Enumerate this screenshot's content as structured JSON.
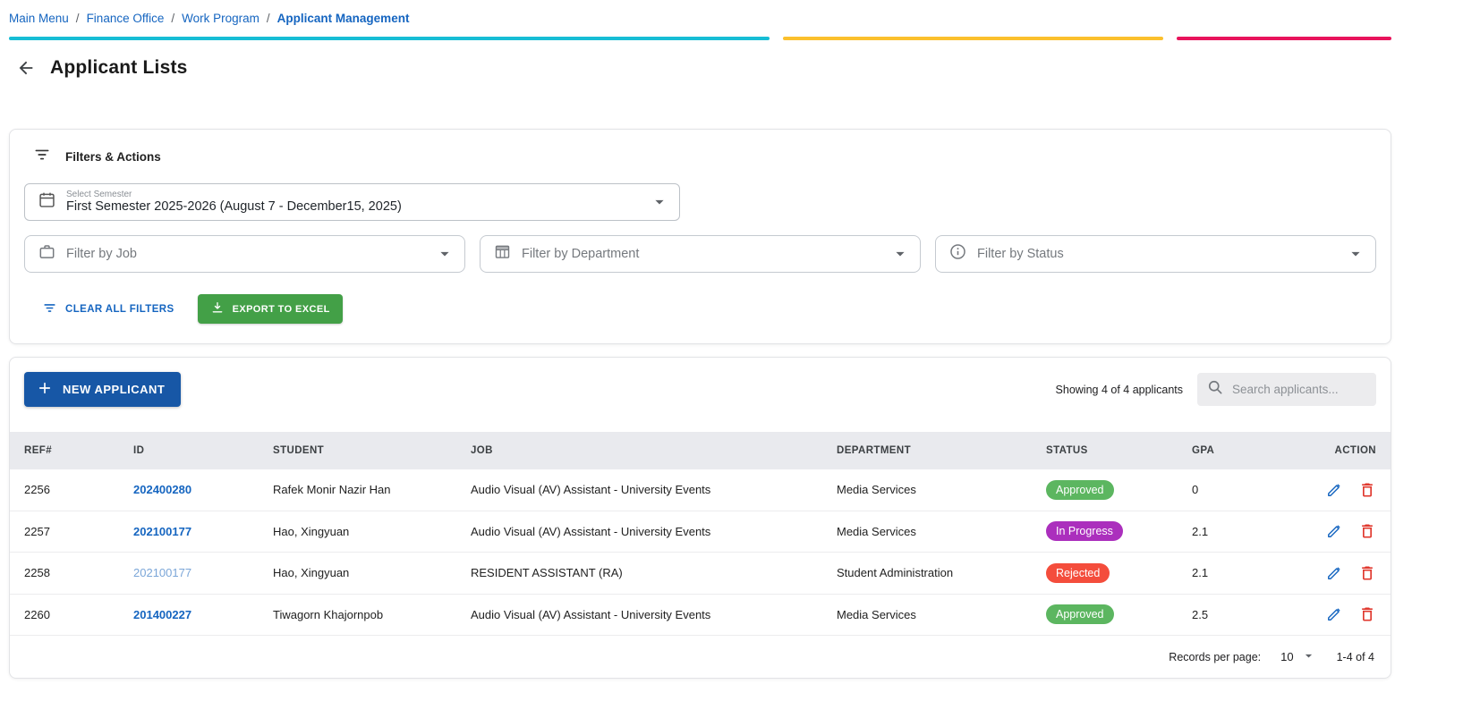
{
  "breadcrumb": {
    "separator": "/",
    "items": [
      {
        "label": "Main Menu",
        "current": false
      },
      {
        "label": "Finance Office",
        "current": false
      },
      {
        "label": "Work Program",
        "current": false
      },
      {
        "label": "Applicant Management",
        "current": true
      }
    ]
  },
  "page": {
    "title": "Applicant Lists"
  },
  "filters": {
    "title": "Filters & Actions",
    "semester_label": "Select Semester",
    "semester_value": "First Semester 2025-2026 (August 7 - December15, 2025)",
    "job_placeholder": "Filter by Job",
    "department_placeholder": "Filter by Department",
    "status_placeholder": "Filter by Status",
    "clear_button_label": "CLEAR ALL FILTERS",
    "export_button_label": "EXPORT TO EXCEL"
  },
  "toolbar": {
    "new_applicant_label": "NEW APPLICANT",
    "showing_text": "Showing 4 of 4 applicants",
    "search_placeholder": "Search applicants..."
  },
  "table": {
    "headers": [
      "REF#",
      "ID",
      "STUDENT",
      "JOB",
      "DEPARTMENT",
      "STATUS",
      "GPA",
      "ACTION"
    ],
    "rows": [
      {
        "ref": "2256",
        "id": "202400280",
        "id_muted": false,
        "student": "Rafek Monir Nazir Han",
        "job": "Audio Visual (AV) Assistant - University Events",
        "department": "Media Services",
        "status": "Approved",
        "status_color": "#5cb660",
        "gpa": "0"
      },
      {
        "ref": "2257",
        "id": "202100177",
        "id_muted": false,
        "student": "Hao, Xingyuan",
        "job": "Audio Visual (AV) Assistant - University Events",
        "department": "Media Services",
        "status": "In Progress",
        "status_color": "#ab2fbd",
        "gpa": "2.1"
      },
      {
        "ref": "2258",
        "id": "202100177",
        "id_muted": true,
        "student": "Hao, Xingyuan",
        "job": "RESIDENT ASSISTANT (RA)",
        "department": "Student Administration",
        "status": "Rejected",
        "status_color": "#f44d3c",
        "gpa": "2.1"
      },
      {
        "ref": "2260",
        "id": "201400227",
        "id_muted": false,
        "student": "Tiwagorn Khajornpob",
        "job": "Audio Visual (AV) Assistant - University Events",
        "department": "Media Services",
        "status": "Approved",
        "status_color": "#5cb660",
        "gpa": "2.5"
      }
    ]
  },
  "pagination": {
    "records_per_page_label": "Records per page:",
    "records_per_page_value": "10",
    "range_text": "1-4 of 4"
  },
  "icons": {
    "back": "arrow-left",
    "filters_header": "filter-list",
    "semester": "calendar",
    "job": "briefcase",
    "department": "grid-table",
    "status": "info-circle",
    "clear": "filter-list",
    "export": "download",
    "new_applicant": "plus",
    "search": "magnifier",
    "dropdown": "caret-down",
    "edit": "pencil",
    "delete": "trash"
  },
  "colors": {
    "primary_blue": "#1565c0",
    "button_blue": "#1757a6",
    "bar_cyan": "#16bdd5",
    "bar_yellow": "#fbc02d",
    "bar_pink": "#e8145c",
    "export_green": "#43a047",
    "status_approved": "#5cb660",
    "status_in_progress": "#ab2fbd",
    "status_rejected": "#f44d3c",
    "edit_blue": "#1565c0",
    "delete_red": "#e0382e",
    "id_link": "#1565c0",
    "id_link_muted": "#7ba6d8"
  }
}
